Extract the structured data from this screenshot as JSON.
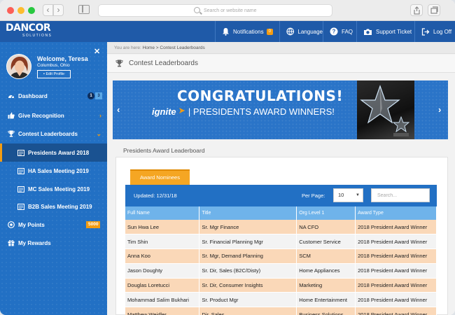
{
  "browser": {
    "url_placeholder": "Search or website name",
    "back_glyph": "‹",
    "forward_glyph": "›"
  },
  "header": {
    "logo_main": "DANCOR",
    "logo_sub": "SOLUTIONS",
    "notifications_label": "Notifications",
    "notifications_count": "0",
    "language_label": "Language",
    "faq_label": "FAQ",
    "support_label": "Support Ticket",
    "logoff_label": "Log Off"
  },
  "profile": {
    "welcome": "Welcome, Teresa",
    "location": "Columbus, Ohio",
    "edit_label": "Edit Profile"
  },
  "sidebar": {
    "close_glyph": "✕",
    "items": [
      {
        "label": "Dashboard",
        "badge1": "1",
        "badge2": "3"
      },
      {
        "label": "Give Recognition",
        "chevron": "›"
      },
      {
        "label": "Contest Leaderboards",
        "chevron": "⌄"
      },
      {
        "label": "Presidents Award 2018"
      },
      {
        "label": "HA Sales Meeting 2019"
      },
      {
        "label": "MC Sales Meeting 2019"
      },
      {
        "label": "B2B Sales Meeting 2019"
      },
      {
        "label": "My Points",
        "badge": "5000"
      },
      {
        "label": "My Rewards"
      }
    ]
  },
  "breadcrumb": {
    "prefix": "You are here:",
    "home": "Home",
    "separator": ">",
    "current": "Contest Leaderboards"
  },
  "page": {
    "title": "Contest Leaderboards"
  },
  "banner": {
    "title": "CONGRATULATIONS!",
    "brand": "ignite",
    "subtitle": "| PRESIDENTS AWARD WINNERS!",
    "prev_glyph": "‹",
    "next_glyph": "›"
  },
  "leaderboard": {
    "section_title": "Presidents Award Leaderboard",
    "tab_label": "Award Nominees",
    "updated": "Updated: 12/31/18",
    "per_page_label": "Per Page:",
    "per_page_value": "10",
    "search_placeholder": "Search...",
    "columns": [
      "Full Name",
      "Title",
      "Org Level 1",
      "Award Type"
    ],
    "rows": [
      [
        "Sun Hwa Lee",
        "Sr. Mgr Finance",
        "NA CFO",
        "2018 President Award Winner"
      ],
      [
        "Tim Shin",
        "Sr. Financial Planning Mgr",
        "Customer Service",
        "2018 President Award Winner"
      ],
      [
        "Anna Koo",
        "Sr. Mgr, Demand Planning",
        "SCM",
        "2018 President Award Winner"
      ],
      [
        "Jason Doughty",
        "Sr. Dir, Sales (B2C/Disty)",
        "Home Appliances",
        "2018 President Award Winner"
      ],
      [
        "Douglas Loretucci",
        "Sr. Dir, Consumer Insights",
        "Marketing",
        "2018 President Award Winner"
      ],
      [
        "Mohammad Salim Bukhari",
        "Sr. Product Mgr",
        "Home Entertainment",
        "2018 President Award Winner"
      ],
      [
        "Matthew Weidler",
        "Dir, Sales",
        "Business Solutions",
        "2018 President Award Winner"
      ]
    ]
  },
  "colors": {
    "brand_blue": "#1f5aa8",
    "sidebar_blue": "#2270c4",
    "accent_orange": "#f39c12"
  }
}
